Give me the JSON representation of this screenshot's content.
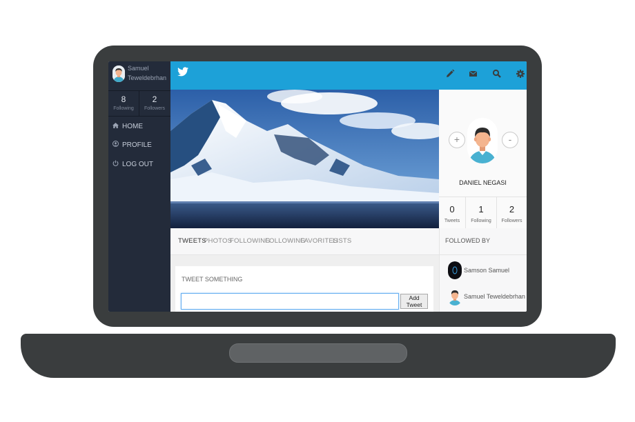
{
  "sidebar": {
    "user_name_line1": "Samuel",
    "user_name_line2": "Teweldebrhan",
    "following_count": "8",
    "following_label": "Following",
    "followers_count": "2",
    "followers_label": "Followers",
    "nav": [
      {
        "label": "HOME",
        "icon": "home-icon"
      },
      {
        "label": "PROFILE",
        "icon": "user-icon"
      },
      {
        "label": "LOG OUT",
        "icon": "power-icon"
      }
    ]
  },
  "topbar": {
    "logo": "twitter-bird-icon",
    "icons": [
      "pencil-icon",
      "envelope-icon",
      "search-icon",
      "gear-icon"
    ],
    "color": "#1da1d8"
  },
  "tabs": [
    "TWEETS",
    "PHOTOS",
    "FOLLOWING",
    "FOLLOWING",
    "FAVORITES",
    "LISTS"
  ],
  "tweet": {
    "title": "TWEET SOMETHING",
    "input_value": "",
    "button_label": "Add Tweet"
  },
  "profile": {
    "name": "DANIEL NEGASI",
    "plus_label": "+",
    "minus_label": "-",
    "stats": [
      {
        "num": "0",
        "label": "Tweets"
      },
      {
        "num": "1",
        "label": "Following"
      },
      {
        "num": "2",
        "label": "Followers"
      }
    ]
  },
  "followed_by": {
    "title": "FOLLOWED BY",
    "items": [
      {
        "name": "Samson Samuel",
        "action": "+"
      },
      {
        "name": "Samuel Teweldebrhan"
      }
    ]
  }
}
